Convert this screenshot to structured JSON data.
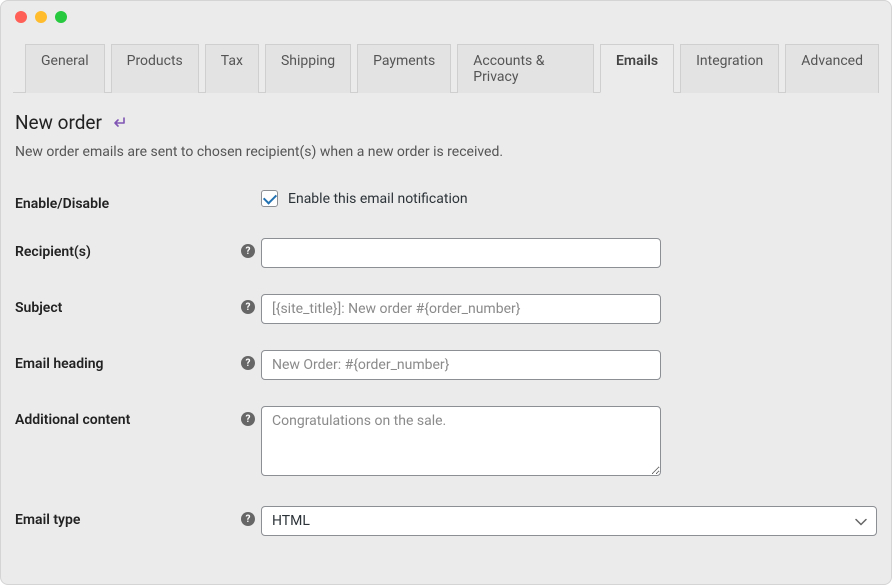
{
  "tabs": [
    {
      "label": "General"
    },
    {
      "label": "Products"
    },
    {
      "label": "Tax"
    },
    {
      "label": "Shipping"
    },
    {
      "label": "Payments"
    },
    {
      "label": "Accounts & Privacy"
    },
    {
      "label": "Emails",
      "active": true
    },
    {
      "label": "Integration"
    },
    {
      "label": "Advanced"
    }
  ],
  "page": {
    "title": "New order",
    "description": "New order emails are sent to chosen recipient(s) when a new order is received."
  },
  "form": {
    "enable_label": "Enable/Disable",
    "enable_checkbox_label": "Enable this email notification",
    "recipients_label": "Recipient(s)",
    "recipients_value": "",
    "subject_label": "Subject",
    "subject_placeholder": "[{site_title}]: New order #{order_number}",
    "subject_value": "",
    "heading_label": "Email heading",
    "heading_placeholder": "New Order: #{order_number}",
    "heading_value": "",
    "additional_label": "Additional content",
    "additional_placeholder": "Congratulations on the sale.",
    "additional_value": "",
    "emailtype_label": "Email type",
    "emailtype_value": "HTML"
  }
}
